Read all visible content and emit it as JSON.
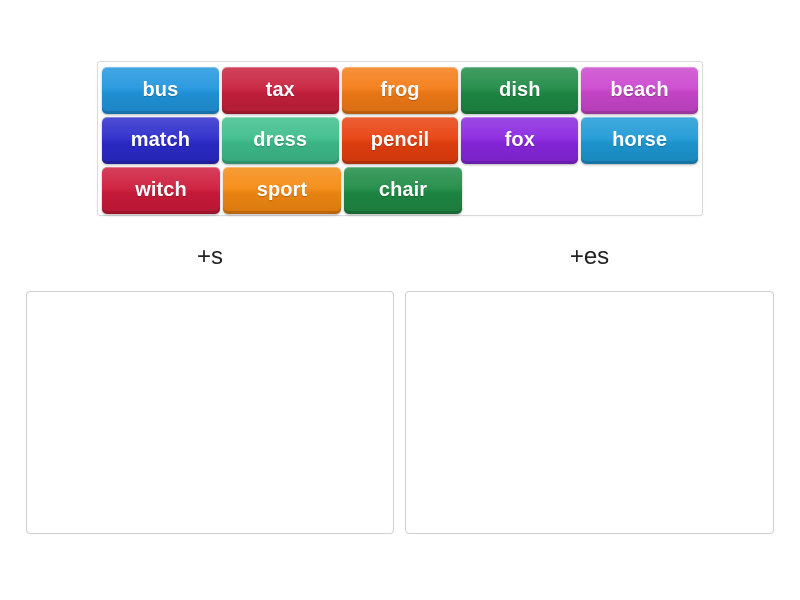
{
  "activity": {
    "type": "group-sort",
    "tray": {
      "rows": [
        [
          {
            "label": "bus",
            "color": "#2196DE"
          },
          {
            "label": "tax",
            "color": "#C8203C"
          },
          {
            "label": "frog",
            "color": "#F47C16"
          },
          {
            "label": "dish",
            "color": "#1E8B45"
          },
          {
            "label": "beach",
            "color": "#CB47CE"
          }
        ],
        [
          {
            "label": "match",
            "color": "#2B2BCB"
          },
          {
            "label": "dress",
            "color": "#3EBE8C"
          },
          {
            "label": "pencil",
            "color": "#E8400E"
          },
          {
            "label": "fox",
            "color": "#8A27E0"
          },
          {
            "label": "horse",
            "color": "#1E9AD6"
          }
        ],
        [
          {
            "label": "witch",
            "color": "#CE1B3B"
          },
          {
            "label": "sport",
            "color": "#F58A12"
          },
          {
            "label": "chair",
            "color": "#1E8B45"
          }
        ]
      ]
    },
    "categories": [
      {
        "label": "+s",
        "items": []
      },
      {
        "label": "+es",
        "items": []
      }
    ]
  }
}
